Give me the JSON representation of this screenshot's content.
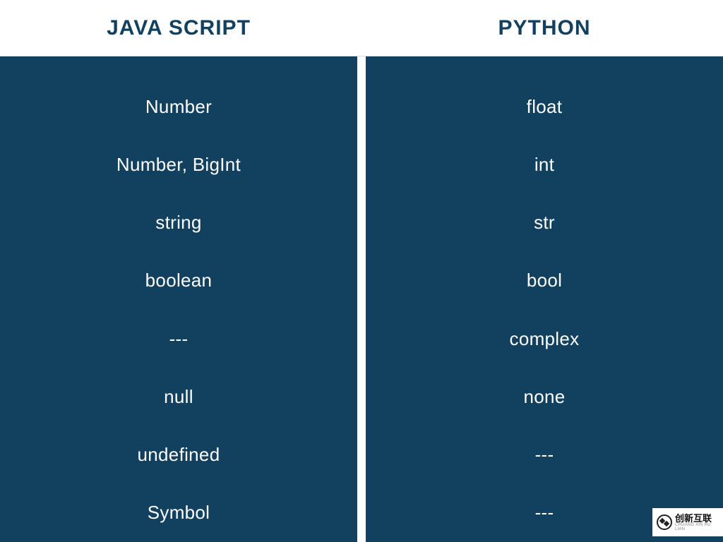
{
  "headers": {
    "left": "JAVA SCRIPT",
    "right": "PYTHON"
  },
  "rows": [
    {
      "js": "Number",
      "py": "float"
    },
    {
      "js": "Number, BigInt",
      "py": "int"
    },
    {
      "js": "string",
      "py": "str"
    },
    {
      "js": "boolean",
      "py": "bool"
    },
    {
      "js": "---",
      "py": "complex"
    },
    {
      "js": "null",
      "py": "none"
    },
    {
      "js": "undefined",
      "py": "---"
    },
    {
      "js": "Symbol",
      "py": "---"
    }
  ],
  "watermark": {
    "cn": "创新互联",
    "en": "CHUANG XIN HU LIAN"
  },
  "colors": {
    "panel": "#124160",
    "text": "#ffffff"
  }
}
